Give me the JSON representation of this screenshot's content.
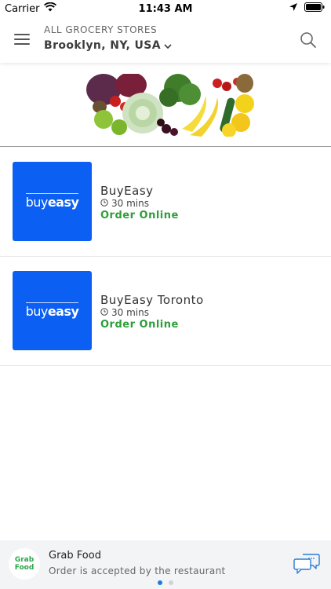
{
  "status_bar": {
    "carrier": "Carrier",
    "time": "11:43 AM"
  },
  "header": {
    "subtitle": "ALL GROCERY STORES",
    "location": "Brooklyn, NY, USA"
  },
  "stores": [
    {
      "name": "BuyEasy",
      "logo_part1": "buy",
      "logo_part2": "easy",
      "time": "30 mins",
      "action": "Order Online"
    },
    {
      "name": "BuyEasy Toronto",
      "logo_part1": "buy",
      "logo_part2": "easy",
      "time": "30 mins",
      "action": "Order Online"
    }
  ],
  "bottom_bar": {
    "logo_line1": "Grab",
    "logo_line2": "Food",
    "title": "Grab Food",
    "subtitle": "Order is accepted by the restaurant",
    "page_count": 2,
    "active_page": 1
  },
  "colors": {
    "brand_blue": "#0b5ff2",
    "order_green": "#2e9e3a",
    "grab_green": "#2aa64a",
    "pager_active": "#1f7ae0"
  },
  "icons": [
    "wifi-icon",
    "location-arrow-icon",
    "battery-icon",
    "menu-icon",
    "chevron-down-icon",
    "search-icon",
    "clock-icon",
    "chat-icon"
  ]
}
